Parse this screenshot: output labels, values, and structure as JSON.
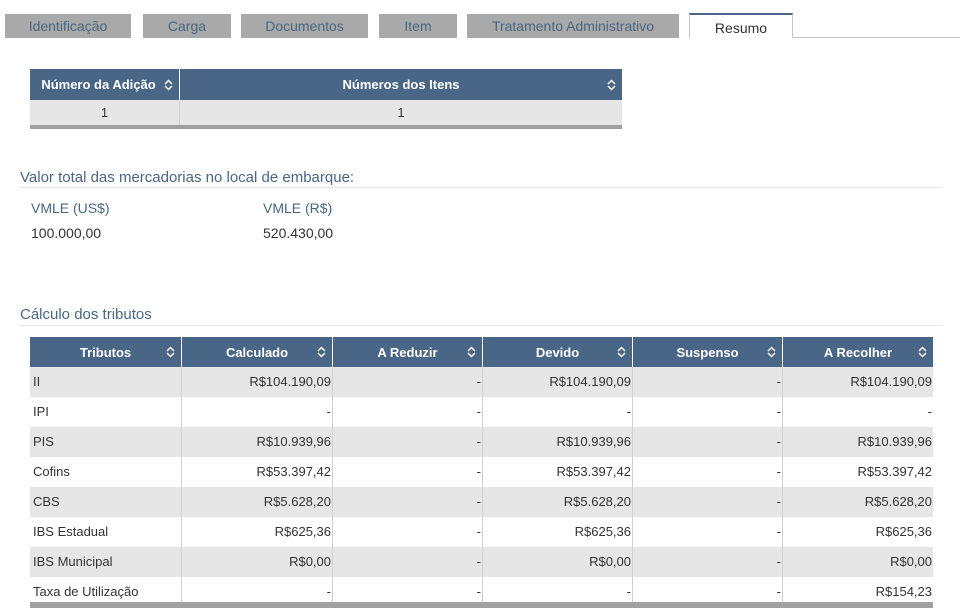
{
  "tabs": [
    {
      "label": "Identificação",
      "active": false
    },
    {
      "label": "Carga",
      "active": false
    },
    {
      "label": "Documentos",
      "active": false
    },
    {
      "label": "Item",
      "active": false
    },
    {
      "label": "Tratamento Administrativo",
      "active": false
    },
    {
      "label": "Resumo",
      "active": true
    }
  ],
  "adicao_table": {
    "headers": [
      "Número da Adição",
      "Números dos Itens"
    ],
    "rows": [
      [
        "1",
        "1"
      ]
    ]
  },
  "valor_total": {
    "title": "Valor total das mercadorias no local de embarque:",
    "vmle_usd_label": "VMLE (US$)",
    "vmle_usd_value": "100.000,00",
    "vmle_brl_label": "VMLE (R$)",
    "vmle_brl_value": "520.430,00"
  },
  "tributos": {
    "title": "Cálculo dos tributos",
    "headers": [
      "Tributos",
      "Calculado",
      "A Reduzir",
      "Devido",
      "Suspenso",
      "A Recolher"
    ],
    "rows": [
      [
        "II",
        "R$104.190,09",
        "-",
        "R$104.190,09",
        "-",
        "R$104.190,09"
      ],
      [
        "IPI",
        "-",
        "-",
        "-",
        "-",
        "-"
      ],
      [
        "PIS",
        "R$10.939,96",
        "-",
        "R$10.939,96",
        "-",
        "R$10.939,96"
      ],
      [
        "Cofins",
        "R$53.397,42",
        "-",
        "R$53.397,42",
        "-",
        "R$53.397,42"
      ],
      [
        "CBS",
        "R$5.628,20",
        "-",
        "R$5.628,20",
        "-",
        "R$5.628,20"
      ],
      [
        "IBS Estadual",
        "R$625,36",
        "-",
        "R$625,36",
        "-",
        "R$625,36"
      ],
      [
        "IBS Municipal",
        "R$0,00",
        "-",
        "R$0,00",
        "-",
        "R$0,00"
      ],
      [
        "Taxa de Utilização",
        "-",
        "-",
        "-",
        "-",
        "R$154,23"
      ]
    ]
  },
  "colors": {
    "header_bg": "#4a6687",
    "tab_bg": "#a9a9a9",
    "link_text": "#4a6684",
    "row_alt": "#e6e6e6"
  }
}
